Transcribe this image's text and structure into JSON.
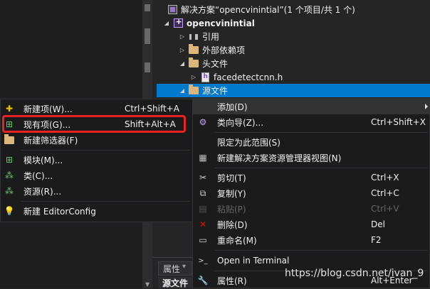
{
  "tree": {
    "solution": "解决方案“opencvinintial”(1 个项目/共 1 个)",
    "project": "opencvinintial",
    "references": "引用",
    "external_deps": "外部依赖项",
    "header_files": "头文件",
    "header_file": "facedetectcnn.h",
    "source_files": "源文件"
  },
  "context_menu": {
    "items": [
      {
        "label": "添加(D)",
        "shortcut": "",
        "icon": "none",
        "submenu": true
      },
      {
        "label": "类向导(Z)...",
        "shortcut": "Ctrl+Shift+X",
        "icon": "class-wizard-icon"
      },
      {
        "label": "限定为此范围(S)",
        "shortcut": "",
        "icon": "none"
      },
      {
        "label": "新建解决方案资源管理器视图(N)",
        "shortcut": "",
        "icon": "new-view-icon"
      },
      {
        "label": "剪切(T)",
        "shortcut": "Ctrl+X",
        "icon": "scissors-icon"
      },
      {
        "label": "复制(Y)",
        "shortcut": "Ctrl+C",
        "icon": "copy-icon"
      },
      {
        "label": "粘贴(P)",
        "shortcut": "Ctrl+V",
        "icon": "paste-icon",
        "disabled": true
      },
      {
        "label": "删除(D)",
        "shortcut": "Del",
        "icon": "delete-icon"
      },
      {
        "label": "重命名(M)",
        "shortcut": "F2",
        "icon": "rename-icon"
      },
      {
        "label": "Open in Terminal",
        "shortcut": "",
        "icon": "terminal-icon"
      },
      {
        "label": "属性(R)",
        "shortcut": "Alt+Enter",
        "icon": "wrench-icon"
      }
    ]
  },
  "add_submenu": {
    "items": [
      {
        "label": "新建项(W)...",
        "shortcut": "Ctrl+Shift+A",
        "icon": "new-item-icon"
      },
      {
        "label": "现有项(G)...",
        "shortcut": "Shift+Alt+A",
        "icon": "existing-item-icon"
      },
      {
        "label": "新建筛选器(F)",
        "shortcut": "",
        "icon": "new-filter-icon"
      },
      {
        "label": "模块(M)...",
        "shortcut": "",
        "icon": "module-icon"
      },
      {
        "label": "类(C)...",
        "shortcut": "",
        "icon": "class-icon"
      },
      {
        "label": "资源(R)...",
        "shortcut": "",
        "icon": "resource-icon"
      },
      {
        "label": "新建 EditorConfig",
        "shortcut": "",
        "icon": "editorconfig-icon"
      }
    ]
  },
  "properties_panel": {
    "tab_label": "属性",
    "title": "源文件"
  },
  "watermark": "https://blog.csdn.net/ivan_9",
  "colors": {
    "selection": "#007acc",
    "menu_bg": "#1b1b1c",
    "highlight_box": "#e82323"
  }
}
